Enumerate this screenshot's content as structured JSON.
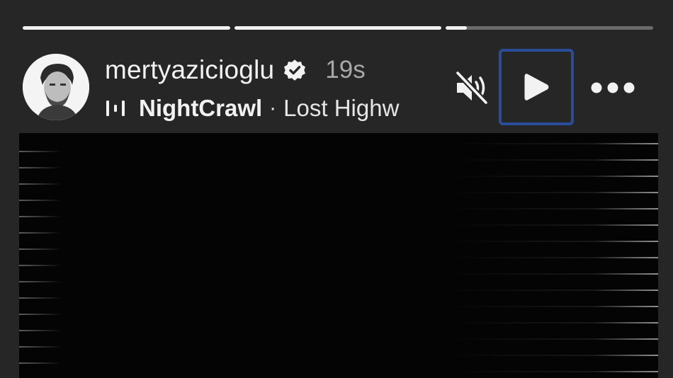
{
  "story": {
    "progress": [
      1.0,
      1.0,
      0.1
    ]
  },
  "header": {
    "username": "mertyazicioglu",
    "verified_icon": "verified-badge-icon",
    "timestamp": "19s"
  },
  "audio": {
    "icon": "audio-equalizer-icon",
    "artist": "NightCrawl",
    "separator": "·",
    "track": "Lost Highw"
  },
  "controls": {
    "mute_icon": "speaker-muted-icon",
    "play_icon": "play-icon",
    "more_icon": "more-options-icon"
  },
  "colors": {
    "background": "#262626",
    "text": "#f2f2f2",
    "muted_text": "#a8a8a8",
    "focus_outline": "#2a4d9b",
    "media_background": "#040404"
  }
}
